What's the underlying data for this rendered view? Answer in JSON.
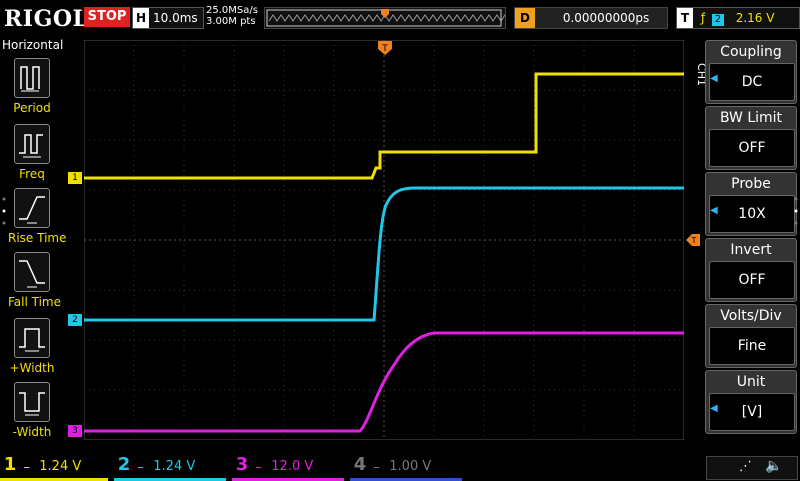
{
  "brand": "RIGOL",
  "run_state": "STOP",
  "horizontal": {
    "key": "H",
    "timebase": "10.0ms",
    "sample_rate": "25.0MSa/s",
    "points": "3.00M pts"
  },
  "delay": {
    "key": "D",
    "value": "0.00000000ps"
  },
  "trigger": {
    "key": "T",
    "source": "2",
    "level": "2.16 V"
  },
  "left_menu": {
    "title": "Horizontal",
    "items": [
      "Period",
      "Freq",
      "Rise Time",
      "Fall Time",
      "+Width",
      "-Width"
    ]
  },
  "right_menu": {
    "channel_tag": "CH1",
    "items": [
      {
        "label": "Coupling",
        "value": "DC"
      },
      {
        "label": "BW Limit",
        "value": "OFF"
      },
      {
        "label": "Probe",
        "value": "10X"
      },
      {
        "label": "Invert",
        "value": "OFF"
      },
      {
        "label": "Volts/Div",
        "value": "Fine"
      },
      {
        "label": "Unit",
        "value": "[V]"
      }
    ]
  },
  "channels": [
    {
      "num": "1",
      "scale": "1.24 V",
      "color": "#f0e000"
    },
    {
      "num": "2",
      "scale": "1.24 V",
      "color": "#1ec8e6"
    },
    {
      "num": "3",
      "scale": "12.0 V",
      "color": "#e020e0"
    },
    {
      "num": "4",
      "scale": "1.00 V",
      "color": "#3050d0"
    }
  ],
  "markers": {
    "ch1": "1",
    "ch2": "2",
    "ch3": "3"
  }
}
